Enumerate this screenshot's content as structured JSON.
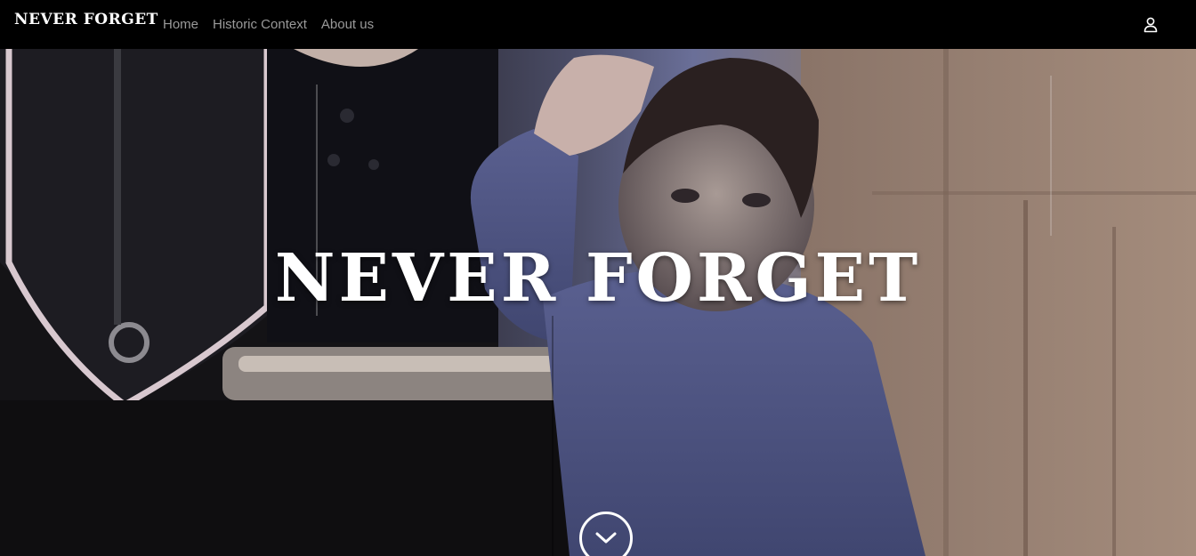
{
  "navbar": {
    "brand": "NEVER FORGET",
    "links": [
      {
        "label": "Home"
      },
      {
        "label": "Historic Context"
      },
      {
        "label": "About us"
      }
    ],
    "user_icon": "user-icon"
  },
  "hero": {
    "title": "NEVER FORGET",
    "scroll_icon": "chevron-down-icon"
  }
}
